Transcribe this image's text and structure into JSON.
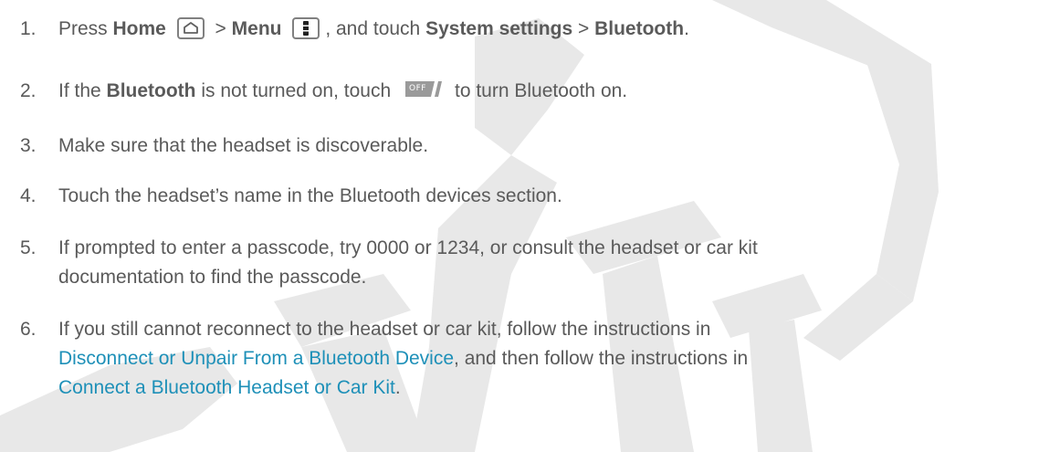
{
  "steps": [
    {
      "num": "1.",
      "t1": "Press ",
      "home": "Home",
      "gt1": " > ",
      "menu": "Menu",
      "t2": ", and touch ",
      "system_settings": "System settings",
      "gt2": " > ",
      "bluetooth": "Bluetooth",
      "end": "."
    },
    {
      "num": "2.",
      "t1": "If the ",
      "bluetooth": "Bluetooth",
      "t2": " is not turned on, touch ",
      "toggle_label": "OFF",
      "t3": "to turn Bluetooth on."
    },
    {
      "num": "3.",
      "text": "Make sure that the headset is discoverable."
    },
    {
      "num": "4.",
      "text": "Touch the headset’s name in the Bluetooth devices section."
    },
    {
      "num": "5.",
      "line1": "If prompted to enter a passcode, try 0000 or 1234, or consult the headset or car kit",
      "line2": "documentation to find the passcode."
    },
    {
      "num": "6.",
      "line1": "If you still cannot reconnect to the headset or car kit, follow the instructions in",
      "link1": "Disconnect or Unpair From a Bluetooth Device",
      "mid": ", and then follow the instructions in",
      "link2": "Connect a Bluetooth Headset or Car Kit",
      "end": "."
    }
  ],
  "icons": {
    "home": "home-key-icon",
    "menu": "menu-key-icon",
    "toggle": "bluetooth-off-toggle-icon"
  },
  "colors": {
    "text": "#5a5a5a",
    "link": "#1e90b8",
    "watermark": "#e8e8e8",
    "toggle": "#9a9a9a"
  }
}
